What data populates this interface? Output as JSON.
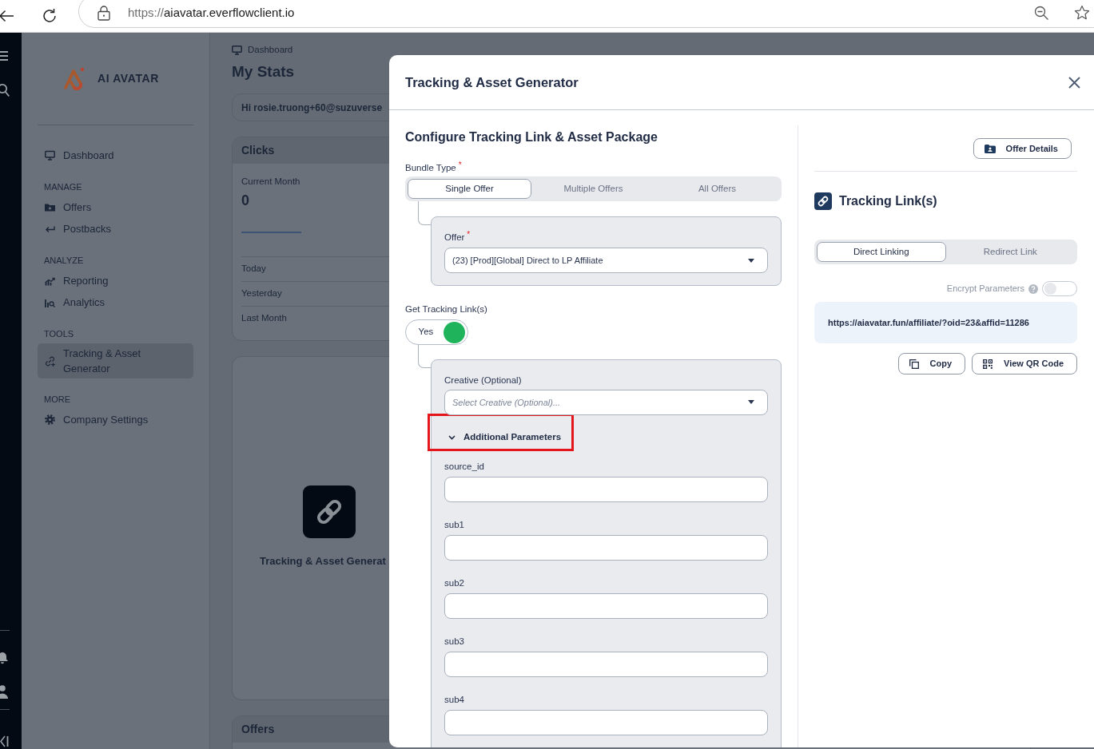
{
  "browser": {
    "url_scheme": "https://",
    "url_host": "aiavatar.everflowclient.io"
  },
  "sidebar": {
    "logo_text": "AI AVATAR",
    "sections": [
      {
        "items": [
          {
            "label": "Dashboard",
            "selected": false
          }
        ]
      },
      {
        "heading": "MANAGE",
        "items": [
          {
            "label": "Offers",
            "selected": false
          },
          {
            "label": "Postbacks",
            "selected": false
          }
        ]
      },
      {
        "heading": "ANALYZE",
        "items": [
          {
            "label": "Reporting",
            "selected": false
          },
          {
            "label": "Analytics",
            "selected": false
          }
        ]
      },
      {
        "heading": "TOOLS",
        "items": [
          {
            "label": "Tracking & Asset Generator",
            "selected": true
          }
        ]
      },
      {
        "heading": "MORE",
        "items": [
          {
            "label": "Company Settings",
            "selected": false
          }
        ]
      }
    ]
  },
  "main": {
    "breadcrumb": "Dashboard",
    "title": "My Stats",
    "greeting": "Hi rosie.truong+60@suzuverse",
    "clicks_card": {
      "title": "Clicks",
      "period": "Current Month",
      "value": "0",
      "rows": [
        "Today",
        "Yesterday",
        "Last Month"
      ]
    },
    "tool_card": {
      "title": "Tracking & Asset Generat"
    },
    "offers_card": {
      "title": "Offers"
    }
  },
  "modal": {
    "title": "Tracking & Asset Generator",
    "configure": {
      "heading": "Configure Tracking Link & Asset Package",
      "bundle_type": {
        "label": "Bundle Type",
        "required_mark": "*",
        "options": [
          {
            "label": "Single Offer",
            "selected": true
          },
          {
            "label": "Multiple Offers",
            "selected": false
          },
          {
            "label": "All Offers",
            "selected": false
          }
        ]
      },
      "offer": {
        "label": "Offer",
        "required_mark": "*",
        "value": "(23) [Prod][Global] Direct to LP Affiliate"
      },
      "get_links": {
        "label": "Get Tracking Link(s)",
        "toggle_label": "Yes",
        "on": true
      },
      "creative": {
        "label": "Creative (Optional)",
        "placeholder": "Select Creative (Optional)..."
      },
      "additional_parameters": {
        "label": "Additional Parameters",
        "expanded": true,
        "highlighted": true,
        "fields": [
          {
            "label": "source_id"
          },
          {
            "label": "sub1"
          },
          {
            "label": "sub2"
          },
          {
            "label": "sub3"
          },
          {
            "label": "sub4"
          }
        ]
      }
    },
    "links": {
      "offer_details_button": "Offer Details",
      "heading": "Tracking Link(s)",
      "link_type": [
        {
          "label": "Direct Linking",
          "selected": true
        },
        {
          "label": "Redirect Link",
          "selected": false
        }
      ],
      "encrypt": {
        "label": "Encrypt Parameters",
        "on": false
      },
      "url": "https://aiavatar.fun/affiliate/?oid=23&affid=11286",
      "buttons": [
        "Copy",
        "View QR Code"
      ]
    }
  }
}
